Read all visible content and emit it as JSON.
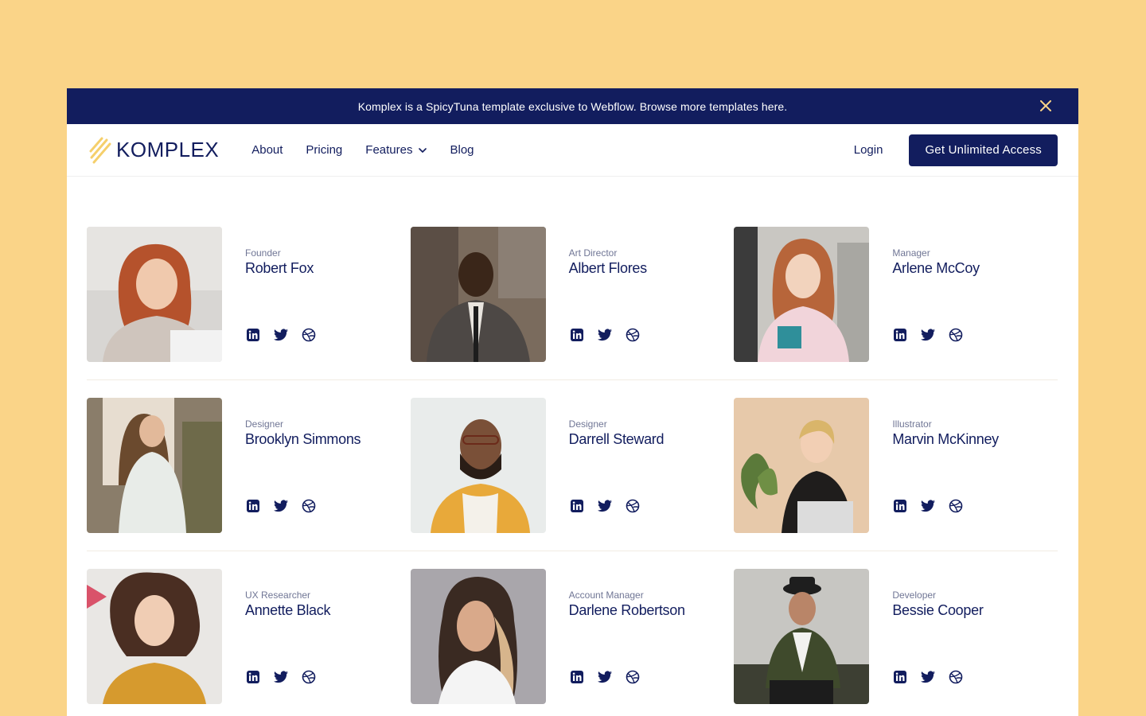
{
  "banner": {
    "text": "Komplex is a SpicyTuna template exclusive to Webflow. Browse more templates here.",
    "close_icon": "close-icon"
  },
  "nav": {
    "brand": "KOMPLEX",
    "items": [
      {
        "label": "About"
      },
      {
        "label": "Pricing"
      },
      {
        "label": "Features",
        "icon": "chevron-down-icon"
      },
      {
        "label": "Blog"
      }
    ],
    "login": "Login",
    "cta": "Get Unlimited Access"
  },
  "colors": {
    "page_bg": "#fad488",
    "navy": "#121d5e",
    "logo_accent": "#f5cf6b",
    "role_text": "#707695"
  },
  "team": [
    {
      "role": "Founder",
      "name": "Robert Fox"
    },
    {
      "role": "Art Director",
      "name": "Albert Flores"
    },
    {
      "role": "Manager",
      "name": "Arlene McCoy"
    },
    {
      "role": "Designer",
      "name": "Brooklyn Simmons"
    },
    {
      "role": "Designer",
      "name": "Darrell Steward"
    },
    {
      "role": "Illustrator",
      "name": "Marvin McKinney"
    },
    {
      "role": "UX Researcher",
      "name": "Annette Black"
    },
    {
      "role": "Account Manager",
      "name": "Darlene Robertson"
    },
    {
      "role": "Developer",
      "name": "Bessie Cooper"
    }
  ],
  "social_icons": [
    "linkedin-icon",
    "twitter-icon",
    "dribbble-icon"
  ]
}
